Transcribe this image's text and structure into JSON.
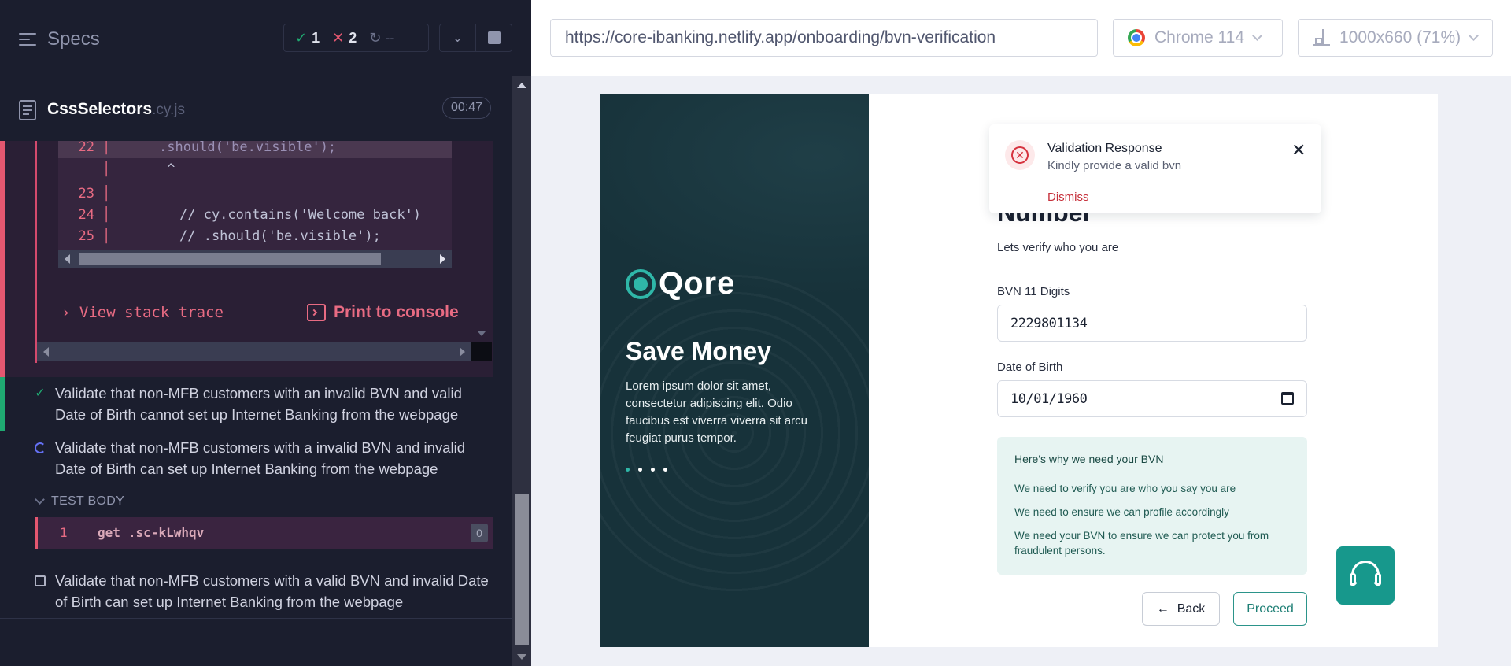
{
  "runner": {
    "specs_label": "Specs",
    "stats": {
      "passed": "1",
      "failed": "2",
      "pending": "--"
    },
    "file": {
      "name": "CssSelectors",
      "ext": ".cy.js",
      "elapsed": "00:47"
    },
    "code_lines": [
      {
        "num": "22",
        "text": ".should('be.visible');",
        "highlight": true
      },
      {
        "num": "",
        "text": " ^",
        "highlight": false
      },
      {
        "num": "23",
        "text": "",
        "highlight": false
      },
      {
        "num": "24",
        "text": "// cy.contains('Welcome back')",
        "highlight": false
      },
      {
        "num": "25",
        "text": "// .should('be.visible');",
        "highlight": false
      }
    ],
    "view_stack_trace": "View stack trace",
    "print_to_console": "Print to console",
    "tests": [
      {
        "status": "passed",
        "title": "Validate that non-MFB customers with an invalid BVN and valid Date of Birth cannot set up Internet Banking from the webpage"
      },
      {
        "status": "running",
        "title": "Validate that non-MFB customers with a invalid BVN and invalid Date of Birth can set up Internet Banking from the webpage"
      },
      {
        "status": "pending",
        "title": "Validate that non-MFB customers with a valid BVN and invalid Date of Birth can set up Internet Banking from the webpage"
      }
    ],
    "test_body_label": "TEST BODY",
    "command": {
      "num": "1",
      "name": "get",
      "selector": ".sc-kLwhqv",
      "count": "0"
    }
  },
  "browser": {
    "url": "https://core-ibanking.netlify.app/onboarding/bvn-verification",
    "browser_name": "Chrome 114",
    "viewport": "1000x660  (71%)"
  },
  "app": {
    "logo_text": "Qore",
    "hero_title": "Save Money",
    "hero_text": "Lorem ipsum dolor sit amet, consectetur adipiscing elit. Odio faucibus est viverra viverra sit arcu feugiat purus tempor.",
    "heading": "Bank Verification Number",
    "subheading": "Lets verify who you are",
    "bvn_label": "BVN 11 Digits",
    "bvn_value": "2229801134",
    "dob_label": "Date of Birth",
    "dob_value": "10/01/1960",
    "why_title": "Here's why we need your BVN",
    "why_items": [
      "We need to verify you are who you say you are",
      "We need to ensure we can profile accordingly",
      "We need your BVN to ensure we can protect you from fraudulent persons."
    ],
    "back_label": "Back",
    "proceed_label": "Proceed",
    "toast": {
      "title": "Validation Response",
      "message": "Kindly provide a valid bvn",
      "dismiss": "Dismiss"
    }
  },
  "colors": {
    "runner_bg": "#1b1e2e",
    "pass": "#1fa971",
    "fail": "#e45770",
    "brand_teal": "#17988c",
    "hero_bg": "#17323a",
    "error_red": "#c62f3a"
  }
}
